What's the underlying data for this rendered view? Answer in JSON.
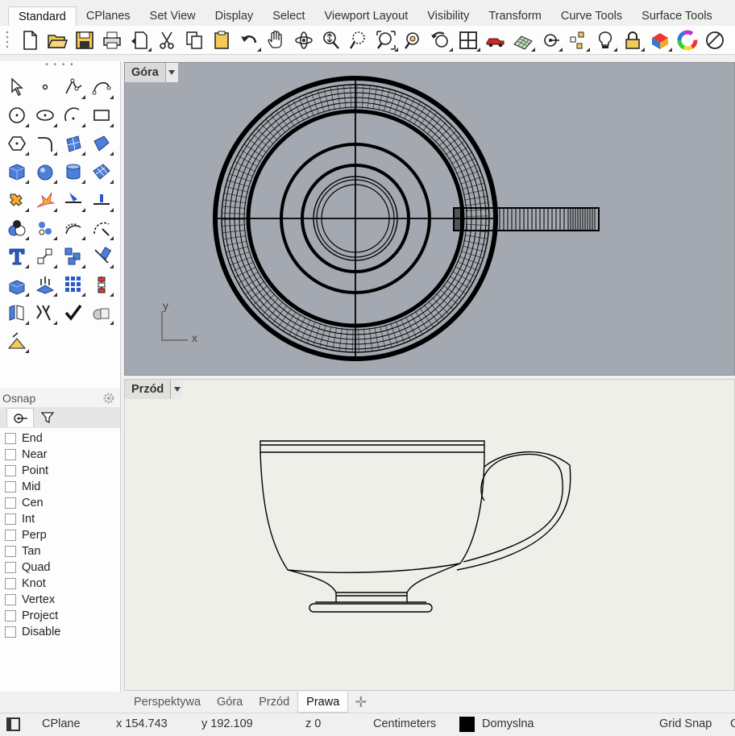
{
  "menu_tabs": [
    "Standard",
    "CPlanes",
    "Set View",
    "Display",
    "Select",
    "Viewport Layout",
    "Visibility",
    "Transform",
    "Curve Tools",
    "Surface Tools"
  ],
  "active_menu_tab": "Standard",
  "toolbar_icons": [
    "new-file-icon",
    "open-folder-icon",
    "save-icon",
    "print-icon",
    "import-icon",
    "cut-icon",
    "copy-icon",
    "paste-icon",
    "undo-icon",
    "pan-hand-icon",
    "rotate-view-icon",
    "zoom-dynamic-icon",
    "zoom-window-icon",
    "zoom-extents-icon",
    "zoom-selected-icon",
    "undo-view-icon",
    "four-viewports-icon",
    "car-icon",
    "grid-options-icon",
    "osnap-icon",
    "points-icon",
    "light-bulb-icon",
    "lock-icon",
    "material-icon",
    "color-wheel-icon",
    "display-mode-icon"
  ],
  "left_tools": [
    "select-arrow-icon",
    "point-icon",
    "polyline-icon",
    "curve-icon",
    "circle-icon",
    "ellipse-icon",
    "arc-icon",
    "rectangle-icon",
    "polygon-icon",
    "fillet-curve-icon",
    "surface-from-points-icon",
    "surface-edit-icon",
    "box-solid-icon",
    "sphere-solid-icon",
    "cylinder-solid-icon",
    "mesh-surface-icon",
    "boolean-union-icon",
    "explode-icon",
    "trim-icon",
    "split-icon",
    "boolean-group-icon",
    "points-on-object-icon",
    "offset-icon",
    "curve-tools-icon",
    "text-icon",
    "scale-icon",
    "array-icon",
    "edit-points-icon",
    "extrude-icon",
    "analyze-icon",
    "grid-array-icon",
    "dimension-icon",
    "cage-edit-icon",
    "transform-mix-icon",
    "check-icon",
    "shaded-solids-icon",
    "mass-properties-icon"
  ],
  "viewports": {
    "top": {
      "name": "Góra",
      "axis_x": "x",
      "axis_y": "y"
    },
    "front": {
      "name": "Przód"
    }
  },
  "osnap": {
    "title": "Osnap",
    "items": [
      {
        "label": "End",
        "checked": false
      },
      {
        "label": "Near",
        "checked": false
      },
      {
        "label": "Point",
        "checked": false
      },
      {
        "label": "Mid",
        "checked": false
      },
      {
        "label": "Cen",
        "checked": false
      },
      {
        "label": "Int",
        "checked": false
      },
      {
        "label": "Perp",
        "checked": false
      },
      {
        "label": "Tan",
        "checked": false
      },
      {
        "label": "Quad",
        "checked": false
      },
      {
        "label": "Knot",
        "checked": false
      },
      {
        "label": "Vertex",
        "checked": false
      },
      {
        "label": "Project",
        "checked": false
      },
      {
        "label": "Disable",
        "checked": false
      }
    ]
  },
  "viewport_tabs": [
    "Perspektywa",
    "Góra",
    "Przód",
    "Prawa"
  ],
  "active_viewport_tab": "Prawa",
  "status": {
    "cplane": "CPlane",
    "x": "x 154.743",
    "y": "y 192.109",
    "z": "z 0",
    "units": "Centimeters",
    "layer": "Domyslna",
    "layer_color": "#000000",
    "grid_snap": "Grid Snap",
    "next_partial": "O"
  },
  "colors": {
    "top_viewport_bg": "#a4a9b1",
    "front_viewport_bg": "#efefea"
  }
}
